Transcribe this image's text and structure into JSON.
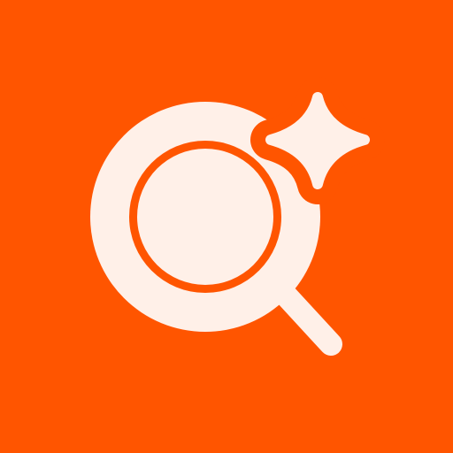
{
  "app_icon": {
    "icon": "magnifier-sparkle-icon",
    "parts": [
      "magnifying-glass-icon",
      "sparkle-icon"
    ],
    "colors": {
      "background": "#FF5500",
      "glyph": "#FFF0E8"
    }
  }
}
